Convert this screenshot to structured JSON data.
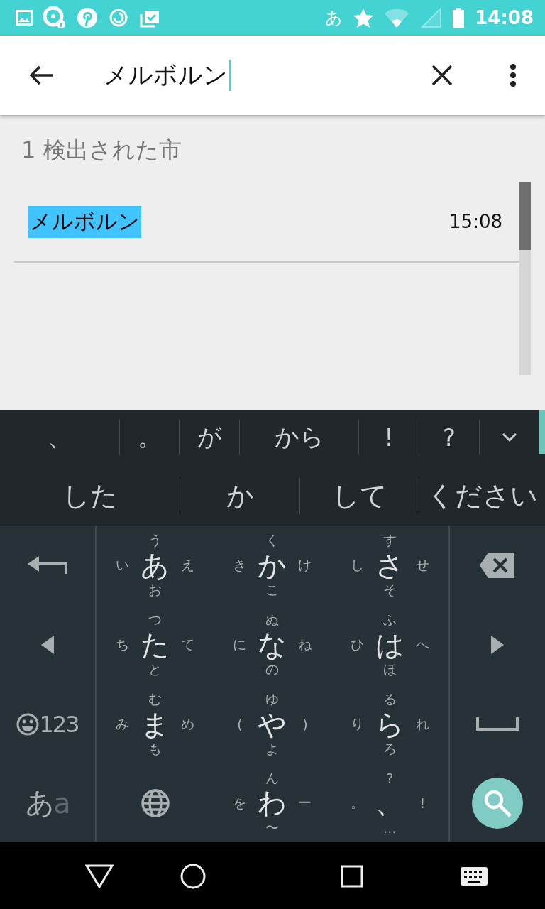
{
  "status_bar": {
    "ime": "あ",
    "time": "14:08"
  },
  "search": {
    "value": "メルボルン"
  },
  "results_header": "1 検出された市",
  "results": [
    {
      "name": "メルボルン",
      "time": "15:08",
      "highlighted": true
    }
  ],
  "suggestions": {
    "row_1": [
      "、",
      "。",
      "が",
      "から",
      "!",
      "?"
    ],
    "row_2": [
      "した",
      "か",
      "して",
      "ください"
    ]
  },
  "keyboard": {
    "rows": [
      {
        "left": {
          "kind": "undo"
        },
        "keys": [
          {
            "center": "あ",
            "top": "う",
            "left": "い",
            "right": "え",
            "bottom": "お"
          },
          {
            "center": "か",
            "top": "く",
            "left": "き",
            "right": "け",
            "bottom": "こ"
          },
          {
            "center": "さ",
            "top": "す",
            "left": "し",
            "right": "せ",
            "bottom": "そ"
          }
        ],
        "right": {
          "kind": "backspace"
        }
      },
      {
        "left": {
          "kind": "cursor_left"
        },
        "keys": [
          {
            "center": "た",
            "top": "つ",
            "left": "ち",
            "right": "て",
            "bottom": "と"
          },
          {
            "center": "な",
            "top": "ぬ",
            "left": "に",
            "right": "ね",
            "bottom": "の"
          },
          {
            "center": "は",
            "top": "ふ",
            "left": "ひ",
            "right": "へ",
            "bottom": "ほ"
          }
        ],
        "right": {
          "kind": "cursor_right"
        }
      },
      {
        "left": {
          "kind": "symbols",
          "label": "123"
        },
        "keys": [
          {
            "center": "ま",
            "top": "む",
            "left": "み",
            "right": "め",
            "bottom": "も"
          },
          {
            "center": "や",
            "top": "ゆ",
            "left": "(",
            "right": ")",
            "bottom": "よ"
          },
          {
            "center": "ら",
            "top": "る",
            "left": "り",
            "right": "れ",
            "bottom": "ろ"
          }
        ],
        "right": {
          "kind": "space"
        }
      },
      {
        "left": {
          "kind": "mode",
          "label": "あ",
          "secondary": "a"
        },
        "keys": [
          {
            "kind": "globe"
          },
          {
            "center": "わ",
            "top": "ん",
            "left": "を",
            "right": "ー",
            "bottom": "〜"
          },
          {
            "center": "、",
            "top": "?",
            "left": "。",
            "right": "!",
            "bottom": "…"
          }
        ],
        "right": {
          "kind": "search"
        }
      }
    ]
  }
}
